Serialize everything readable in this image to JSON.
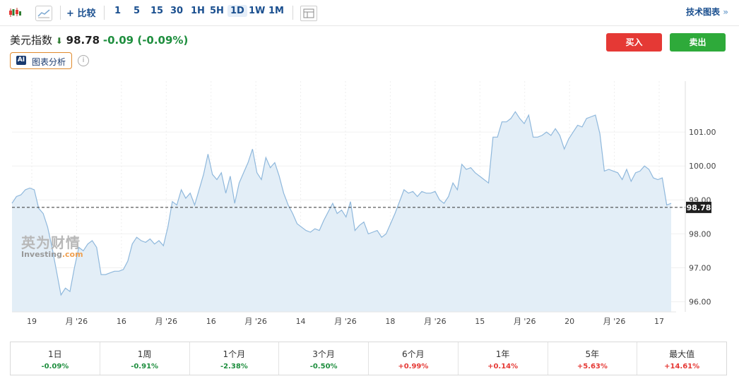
{
  "toolbar": {
    "compare_label": "比较",
    "timeframes": [
      "1",
      "5",
      "15",
      "30",
      "1H",
      "5H",
      "1D",
      "1W",
      "1M"
    ],
    "active_timeframe": "1D",
    "technical_chart_label": "技术图表",
    "technical_chart_arrow": "»"
  },
  "instrument": {
    "name": "美元指数",
    "direction_arrow": "⬇",
    "price": "98.78",
    "change": "-0.09 (-0.09%)"
  },
  "ai": {
    "badge": "AI",
    "label": "图表分析"
  },
  "actions": {
    "buy": "买入",
    "sell": "卖出"
  },
  "watermark": {
    "cn": "英为财情",
    "en": "Investing",
    "en_suffix": ".com"
  },
  "colors": {
    "up": "#e53935",
    "down": "#1e8e3e",
    "area_fill": "#e3eef7",
    "area_line": "#8fb8dc",
    "buy": "#e53935",
    "sell": "#2eaa3a"
  },
  "chart_data": {
    "type": "area",
    "ylim": [
      95.7,
      102.5
    ],
    "yticks": [
      "96.00",
      "97.00",
      "98.00",
      "99.00",
      "100.00",
      "101.00"
    ],
    "x_labels": [
      "19",
      "月 '26",
      "16",
      "月 '26",
      "16",
      "月 '26",
      "14",
      "月 '26",
      "18",
      "月 '26",
      "15",
      "月 '26",
      "20",
      "月 '26",
      "17"
    ],
    "current_value_label": "98.78",
    "current_value": 98.78,
    "values": [
      98.9,
      99.1,
      99.15,
      99.3,
      99.35,
      99.3,
      98.75,
      98.6,
      98.2,
      97.6,
      96.9,
      96.2,
      96.4,
      96.3,
      97.0,
      97.6,
      97.5,
      97.7,
      97.8,
      97.6,
      96.8,
      96.8,
      96.85,
      96.9,
      96.9,
      96.95,
      97.2,
      97.7,
      97.9,
      97.8,
      97.75,
      97.85,
      97.7,
      97.8,
      97.65,
      98.2,
      98.95,
      98.85,
      99.3,
      99.05,
      99.2,
      98.85,
      99.3,
      99.75,
      100.35,
      99.75,
      99.6,
      99.8,
      99.2,
      99.7,
      98.9,
      99.5,
      99.8,
      100.1,
      100.5,
      99.8,
      99.6,
      100.25,
      99.95,
      100.1,
      99.7,
      99.2,
      98.85,
      98.6,
      98.3,
      98.2,
      98.1,
      98.05,
      98.15,
      98.1,
      98.4,
      98.65,
      98.9,
      98.6,
      98.7,
      98.5,
      98.95,
      98.1,
      98.25,
      98.35,
      98.0,
      98.05,
      98.1,
      97.9,
      98.0,
      98.3,
      98.6,
      98.95,
      99.3,
      99.2,
      99.25,
      99.1,
      99.25,
      99.2,
      99.2,
      99.25,
      99.0,
      98.9,
      99.1,
      99.5,
      99.3,
      100.05,
      99.9,
      99.95,
      99.8,
      99.7,
      99.6,
      99.5,
      100.85,
      100.85,
      101.3,
      101.3,
      101.4,
      101.6,
      101.4,
      101.25,
      101.5,
      100.85,
      100.85,
      100.9,
      101.0,
      100.9,
      101.1,
      100.9,
      100.5,
      100.8,
      101.0,
      101.2,
      101.15,
      101.4,
      101.45,
      101.5,
      100.95,
      99.85,
      99.9,
      99.85,
      99.8,
      99.6,
      99.9,
      99.55,
      99.8,
      99.85,
      100.0,
      99.9,
      99.65,
      99.6,
      99.65,
      98.85,
      98.9
    ]
  },
  "performance": [
    {
      "label": "1日",
      "value": "-0.09%",
      "dir": "neg"
    },
    {
      "label": "1周",
      "value": "-0.91%",
      "dir": "neg"
    },
    {
      "label": "1个月",
      "value": "-2.38%",
      "dir": "neg"
    },
    {
      "label": "3个月",
      "value": "-0.50%",
      "dir": "neg"
    },
    {
      "label": "6个月",
      "value": "+0.99%",
      "dir": "pos"
    },
    {
      "label": "1年",
      "value": "+0.14%",
      "dir": "pos"
    },
    {
      "label": "5年",
      "value": "+5.63%",
      "dir": "pos"
    },
    {
      "label": "最大值",
      "value": "+14.61%",
      "dir": "pos"
    }
  ]
}
